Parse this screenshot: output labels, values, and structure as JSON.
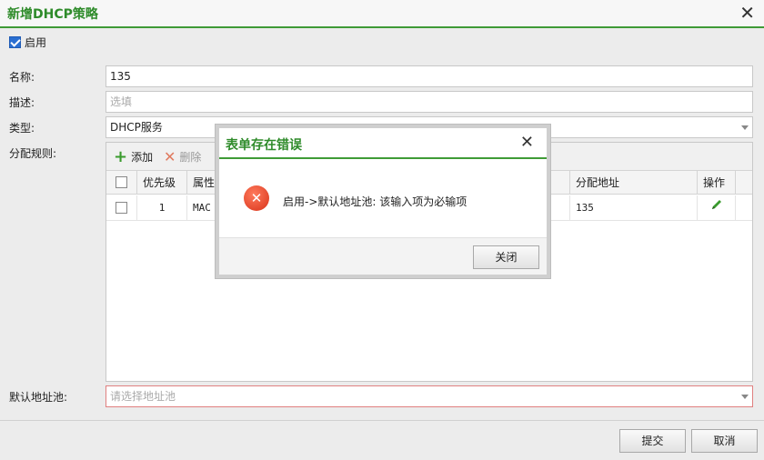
{
  "window": {
    "title": "新增DHCP策略",
    "close_glyph": "✕"
  },
  "form": {
    "enable_label": "启用",
    "enable_checked": true,
    "name_label": "名称:",
    "name_value": "135",
    "desc_label": "描述:",
    "desc_placeholder": "选填",
    "type_label": "类型:",
    "type_value": "DHCP服务",
    "rules_label": "分配规则:",
    "default_pool_label": "默认地址池:",
    "default_pool_placeholder": "请选择地址池"
  },
  "rules": {
    "toolbar": {
      "add_label": "添加",
      "delete_label": "删除"
    },
    "columns": [
      "优先级",
      "属性",
      "分配地址",
      "操作"
    ],
    "rows": [
      {
        "priority": "1",
        "attribute": "MAC C",
        "address": "135"
      }
    ]
  },
  "footer": {
    "submit_label": "提交",
    "cancel_label": "取消"
  },
  "modal": {
    "title": "表单存在错误",
    "close_glyph": "✕",
    "message": "启用->默认地址池: 该输入项为必输项",
    "close_button_label": "关闭"
  },
  "colors": {
    "accent_green": "#2e8b2a",
    "title_border_green": "#3f9b36",
    "error_red": "#d8331a"
  }
}
